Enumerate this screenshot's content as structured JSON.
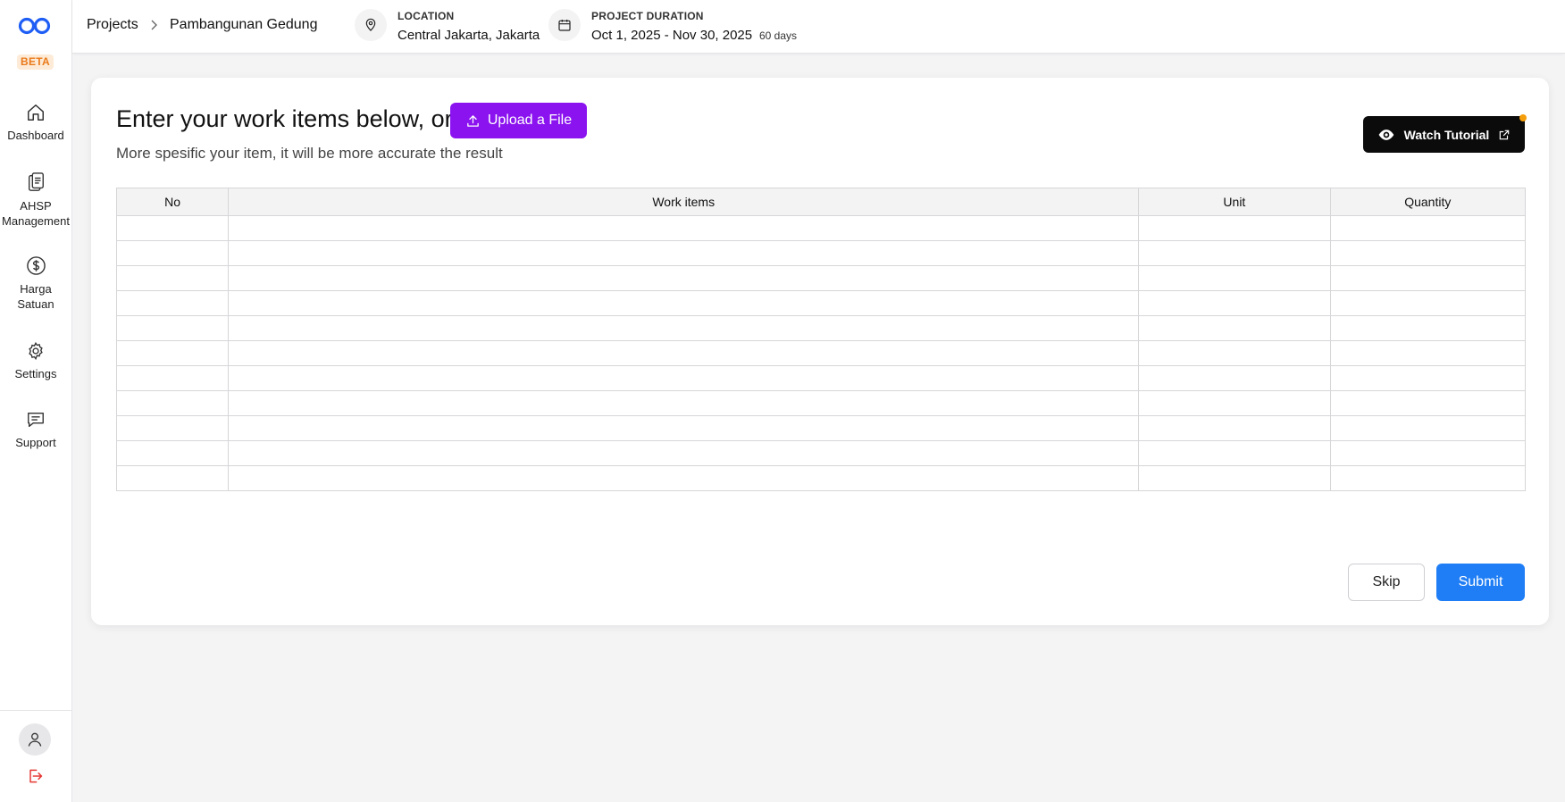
{
  "brand": {
    "beta_badge": "BETA",
    "logo_icon": "infinity-logo-icon",
    "accent": "#1f5ef5"
  },
  "sidebar": {
    "items": [
      {
        "label": "Dashboard",
        "icon": "home-icon"
      },
      {
        "label": "AHSP Management",
        "line1": "AHSP",
        "line2": "Management",
        "icon": "clipboard-icon"
      },
      {
        "label": "Harga Satuan",
        "line1": "Harga",
        "line2": "Satuan",
        "icon": "dollar-circle-icon"
      },
      {
        "label": "Settings",
        "icon": "gear-icon"
      },
      {
        "label": "Support",
        "icon": "chat-icon"
      }
    ],
    "bottom": {
      "avatar_icon": "user-icon",
      "logout_icon": "logout-icon"
    }
  },
  "header": {
    "breadcrumb": {
      "root": "Projects",
      "current": "Pambangunan Gedung"
    },
    "location": {
      "label": "LOCATION",
      "value": "Central Jakarta, Jakarta",
      "icon": "map-pin-icon"
    },
    "duration": {
      "label": "PROJECT DURATION",
      "value": "Oct 1, 2025 - Nov 30, 2025",
      "days": "60 days",
      "icon": "calendar-icon"
    }
  },
  "main": {
    "title": "Enter your work items below, or",
    "upload_button": "Upload a File",
    "subtitle": "More spesific your item, it will be more accurate the result",
    "watch_tutorial": "Watch Tutorial",
    "table": {
      "columns": [
        "No",
        "Work items",
        "Unit",
        "Quantity"
      ],
      "row_count": 11
    },
    "skip_button": "Skip",
    "submit_button": "Submit"
  },
  "colors": {
    "upload": "#8b13ef",
    "submit": "#1f7ef5",
    "beta_text": "#ea7a1b",
    "logout": "#e53935"
  }
}
